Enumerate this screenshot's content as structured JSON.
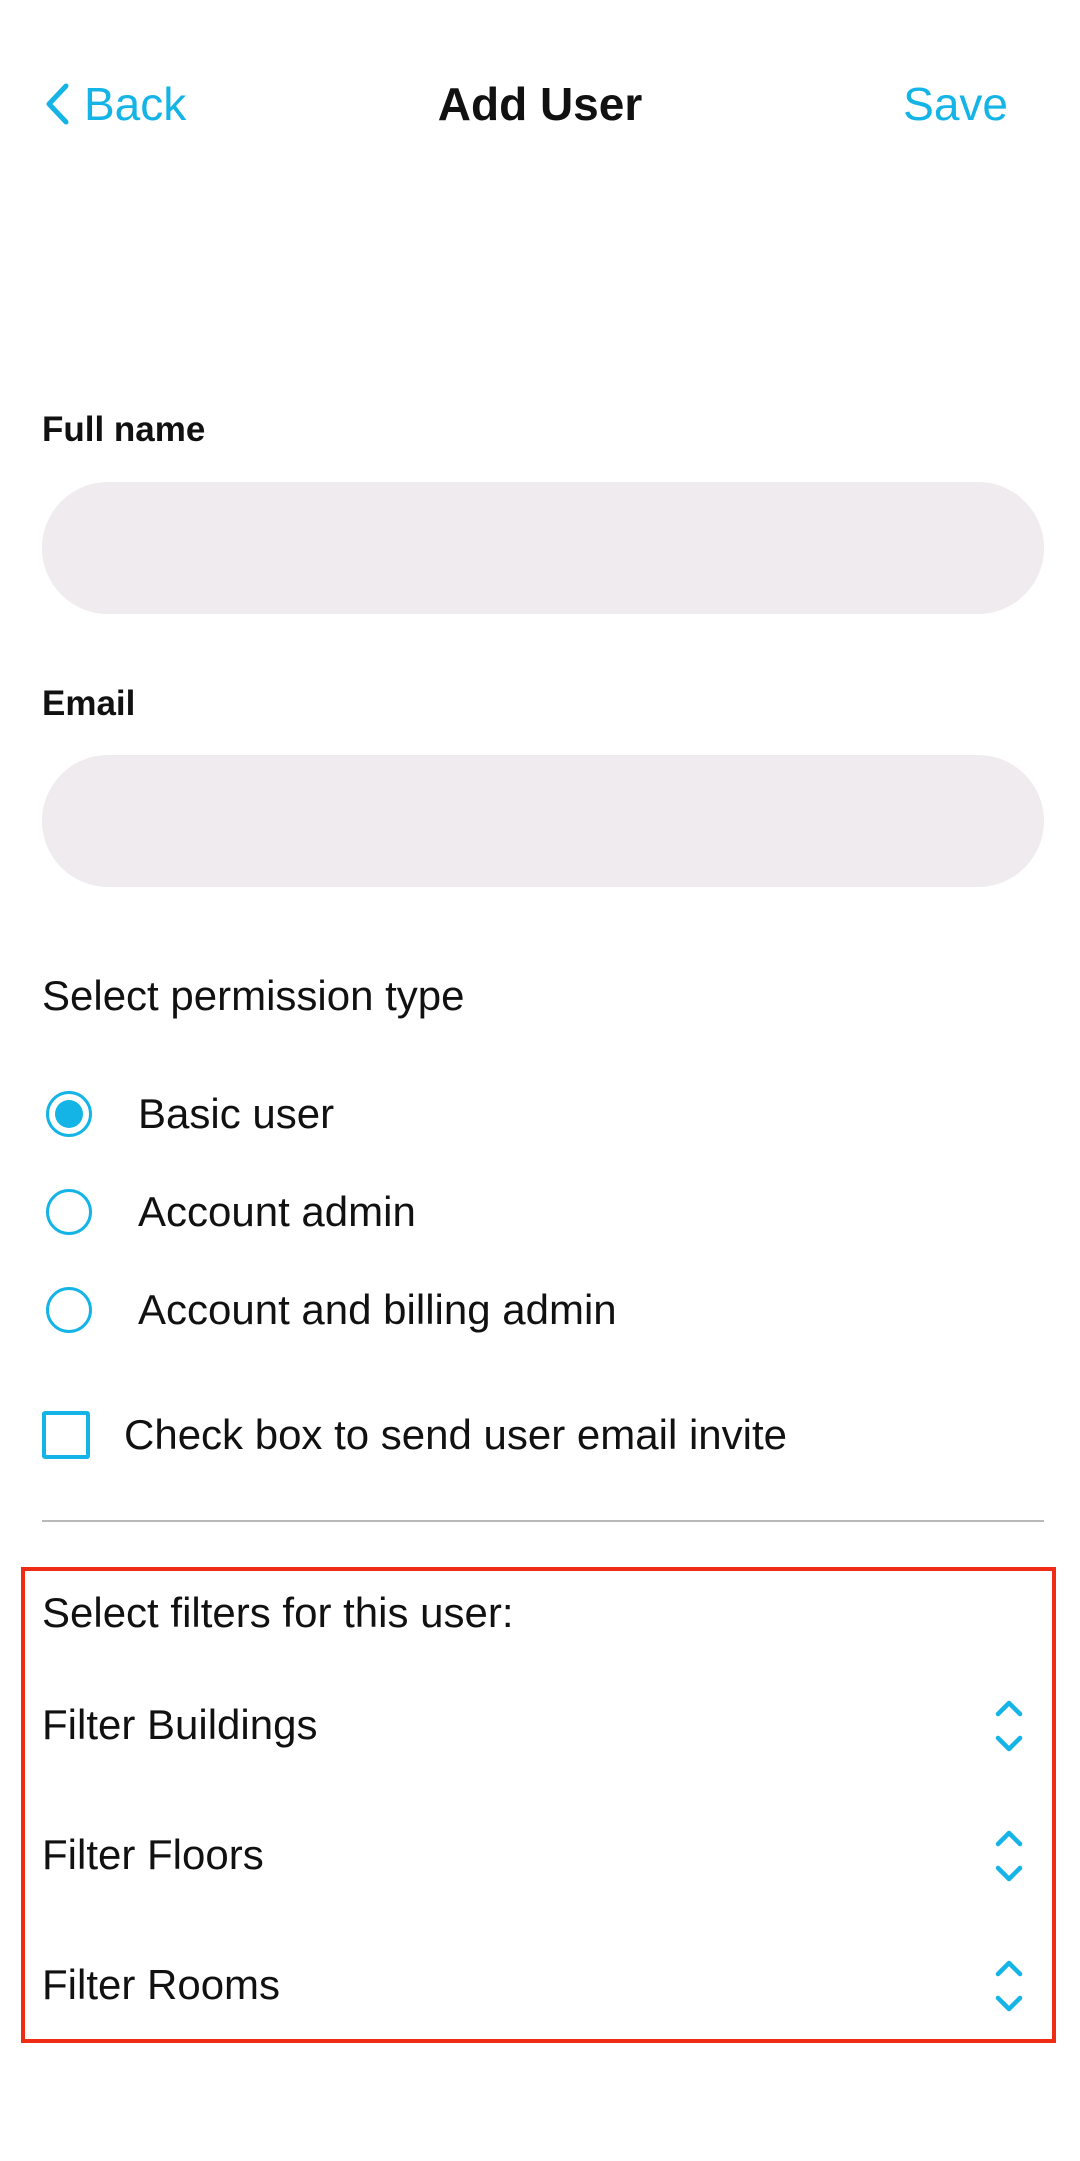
{
  "header": {
    "back_label": "Back",
    "title": "Add User",
    "save_label": "Save"
  },
  "form": {
    "full_name": {
      "label": "Full name",
      "value": "",
      "placeholder": ""
    },
    "email": {
      "label": "Email",
      "value": "",
      "placeholder": ""
    },
    "permission": {
      "label": "Select permission type",
      "options": [
        {
          "label": "Basic user",
          "selected": true
        },
        {
          "label": "Account admin",
          "selected": false
        },
        {
          "label": "Account and billing admin",
          "selected": false
        }
      ]
    },
    "invite": {
      "label": "Check box to send user email invite",
      "checked": false
    }
  },
  "filters": {
    "heading": "Select filters for this user:",
    "items": [
      {
        "label": "Filter Buildings",
        "icon": "chevron-up-down-icon"
      },
      {
        "label": "Filter Floors",
        "icon": "chevron-up-down-icon"
      },
      {
        "label": "Filter Rooms",
        "icon": "chevron-up-down-icon"
      }
    ]
  },
  "colors": {
    "accent": "#14b4e6",
    "input_bg": "#efebee",
    "highlight_border": "#f02d14",
    "divider": "#b9b9b9"
  }
}
